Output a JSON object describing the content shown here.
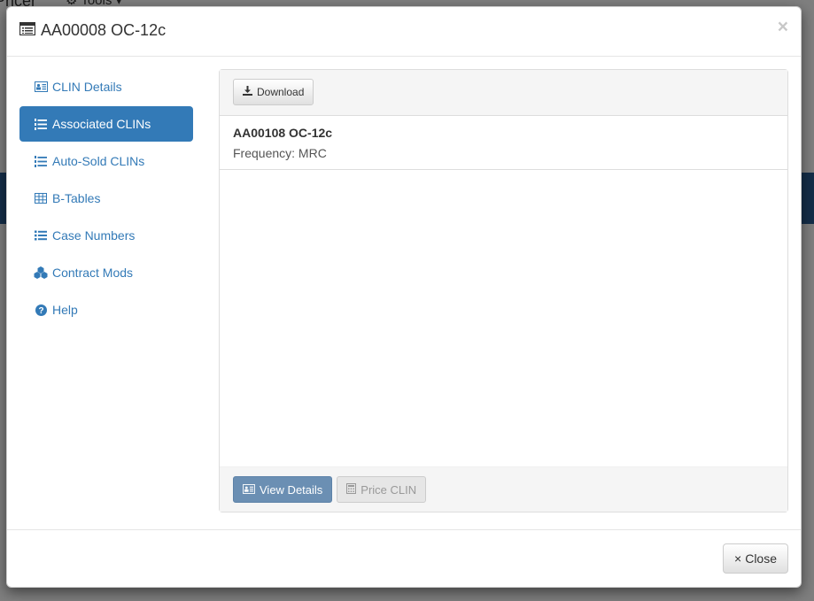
{
  "background": {
    "brand_partial": "Pricer",
    "tools_menu": "Tools ▾"
  },
  "modal": {
    "title": "AA00008 OC-12c",
    "title_icon": "list-alt-icon",
    "close_symbol": "×"
  },
  "sidebar": {
    "items": [
      {
        "label": "CLIN Details",
        "icon": "vcard-icon",
        "active": false
      },
      {
        "label": "Associated CLINs",
        "icon": "ordered-list-icon",
        "active": true
      },
      {
        "label": "Auto-Sold CLINs",
        "icon": "ordered-list-icon",
        "active": false
      },
      {
        "label": "B-Tables",
        "icon": "table-icon",
        "active": false
      },
      {
        "label": "Case Numbers",
        "icon": "list-icon",
        "active": false
      },
      {
        "label": "Contract Mods",
        "icon": "cubes-icon",
        "active": false
      },
      {
        "label": "Help",
        "icon": "question-circle-icon",
        "active": false
      }
    ]
  },
  "panel": {
    "download_label": "Download",
    "items": [
      {
        "title": "AA00108 OC-12c",
        "frequency": "Frequency: MRC"
      }
    ],
    "view_details_label": "View Details",
    "price_clin_label": "Price CLIN"
  },
  "footer": {
    "close_label": "Close",
    "close_symbol": "×"
  },
  "colors": {
    "accent": "#337ab7",
    "overlay_band": "#285c93"
  }
}
